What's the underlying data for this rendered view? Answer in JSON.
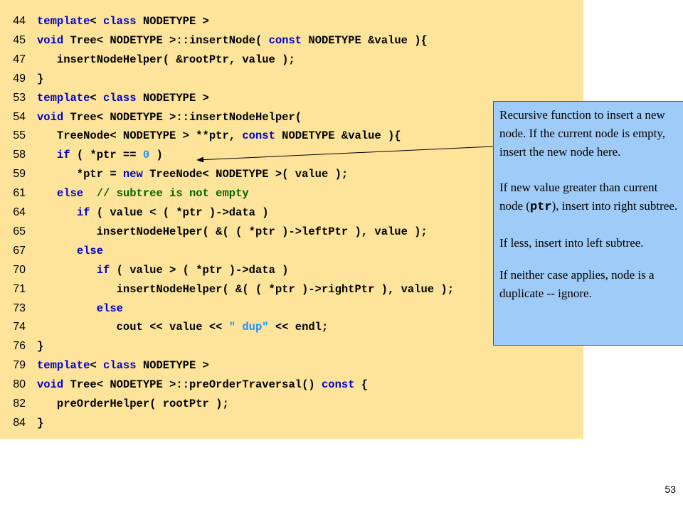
{
  "code_lines": [
    {
      "num": "44",
      "segments": [
        {
          "t": "template",
          "c": "kw"
        },
        {
          "t": "< ",
          "c": ""
        },
        {
          "t": "class",
          "c": "kw"
        },
        {
          "t": " NODETYPE >",
          "c": ""
        }
      ]
    },
    {
      "num": "45",
      "segments": [
        {
          "t": "void",
          "c": "kw"
        },
        {
          "t": " Tree< NODETYPE >::insertNode( ",
          "c": ""
        },
        {
          "t": "const",
          "c": "kw"
        },
        {
          "t": " NODETYPE &value ){",
          "c": ""
        }
      ]
    },
    {
      "num": "47",
      "segments": [
        {
          "t": "   insertNodeHelper( &rootPtr, value );",
          "c": ""
        }
      ]
    },
    {
      "num": "49",
      "segments": [
        {
          "t": "}",
          "c": ""
        }
      ]
    },
    {
      "num": "53",
      "segments": [
        {
          "t": "template",
          "c": "kw"
        },
        {
          "t": "< ",
          "c": ""
        },
        {
          "t": "class",
          "c": "kw"
        },
        {
          "t": " NODETYPE >",
          "c": ""
        }
      ]
    },
    {
      "num": "54",
      "segments": [
        {
          "t": "void",
          "c": "kw"
        },
        {
          "t": " Tree< NODETYPE >::insertNodeHelper(",
          "c": ""
        }
      ]
    },
    {
      "num": "55",
      "segments": [
        {
          "t": "   TreeNode< NODETYPE > **ptr, ",
          "c": ""
        },
        {
          "t": "const",
          "c": "kw"
        },
        {
          "t": " NODETYPE &value ){",
          "c": ""
        }
      ]
    },
    {
      "num": "58",
      "segments": [
        {
          "t": "   ",
          "c": ""
        },
        {
          "t": "if",
          "c": "kw"
        },
        {
          "t": " ( *ptr == ",
          "c": ""
        },
        {
          "t": "0",
          "c": "nm"
        },
        {
          "t": " )",
          "c": ""
        }
      ]
    },
    {
      "num": "59",
      "segments": [
        {
          "t": "      *ptr = ",
          "c": ""
        },
        {
          "t": "new",
          "c": "kw"
        },
        {
          "t": " TreeNode< NODETYPE >( value );",
          "c": ""
        }
      ]
    },
    {
      "num": "61",
      "segments": [
        {
          "t": "   ",
          "c": ""
        },
        {
          "t": "else",
          "c": "kw"
        },
        {
          "t": "  ",
          "c": ""
        },
        {
          "t": "// subtree is not empty",
          "c": "cm"
        }
      ]
    },
    {
      "num": "64",
      "segments": [
        {
          "t": "      ",
          "c": ""
        },
        {
          "t": "if",
          "c": "kw"
        },
        {
          "t": " ( value < ( *ptr )->data )",
          "c": ""
        }
      ]
    },
    {
      "num": "65",
      "segments": [
        {
          "t": "         insertNodeHelper( &( ( *ptr )->leftPtr ), value );",
          "c": ""
        }
      ]
    },
    {
      "num": "67",
      "segments": [
        {
          "t": "      ",
          "c": ""
        },
        {
          "t": "else",
          "c": "kw"
        }
      ]
    },
    {
      "num": "70",
      "segments": [
        {
          "t": "         ",
          "c": ""
        },
        {
          "t": "if",
          "c": "kw"
        },
        {
          "t": " ( value > ( *ptr )->data )",
          "c": ""
        }
      ]
    },
    {
      "num": "71",
      "segments": [
        {
          "t": "            insertNodeHelper( &( ( *ptr )->rightPtr ), value );",
          "c": ""
        }
      ]
    },
    {
      "num": "73",
      "segments": [
        {
          "t": "         ",
          "c": ""
        },
        {
          "t": "else",
          "c": "kw"
        }
      ]
    },
    {
      "num": "74",
      "segments": [
        {
          "t": "            cout << value << ",
          "c": ""
        },
        {
          "t": "\" dup\"",
          "c": "st"
        },
        {
          "t": " << endl;",
          "c": ""
        }
      ]
    },
    {
      "num": "76",
      "segments": [
        {
          "t": "}",
          "c": ""
        }
      ]
    },
    {
      "num": "79",
      "segments": [
        {
          "t": "template",
          "c": "kw"
        },
        {
          "t": "< ",
          "c": ""
        },
        {
          "t": "class",
          "c": "kw"
        },
        {
          "t": " NODETYPE >",
          "c": ""
        }
      ]
    },
    {
      "num": "80",
      "segments": [
        {
          "t": "void",
          "c": "kw"
        },
        {
          "t": " Tree< NODETYPE >::preOrderTraversal() ",
          "c": ""
        },
        {
          "t": "const",
          "c": "kw"
        },
        {
          "t": " {",
          "c": ""
        }
      ]
    },
    {
      "num": "82",
      "segments": [
        {
          "t": "   preOrderHelper( rootPtr );",
          "c": ""
        }
      ]
    },
    {
      "num": "84",
      "segments": [
        {
          "t": "}",
          "c": ""
        }
      ]
    }
  ],
  "callout": {
    "p1": "Recursive function to insert a new node. If the current node is empty, insert the new node here.",
    "p2_pre": "If new value greater than current node (",
    "p2_code": "ptr",
    "p2_post": "), insert into right subtree.",
    "p3": "If less, insert into left subtree.",
    "p4": "If neither case applies, node is a duplicate -- ignore."
  },
  "page_number": "53",
  "colors": {
    "code_background": "#fde49a",
    "callout_background": "#9ecbf7",
    "keyword": "#0000cc",
    "comment": "#006600",
    "literal": "#1e90ff"
  }
}
